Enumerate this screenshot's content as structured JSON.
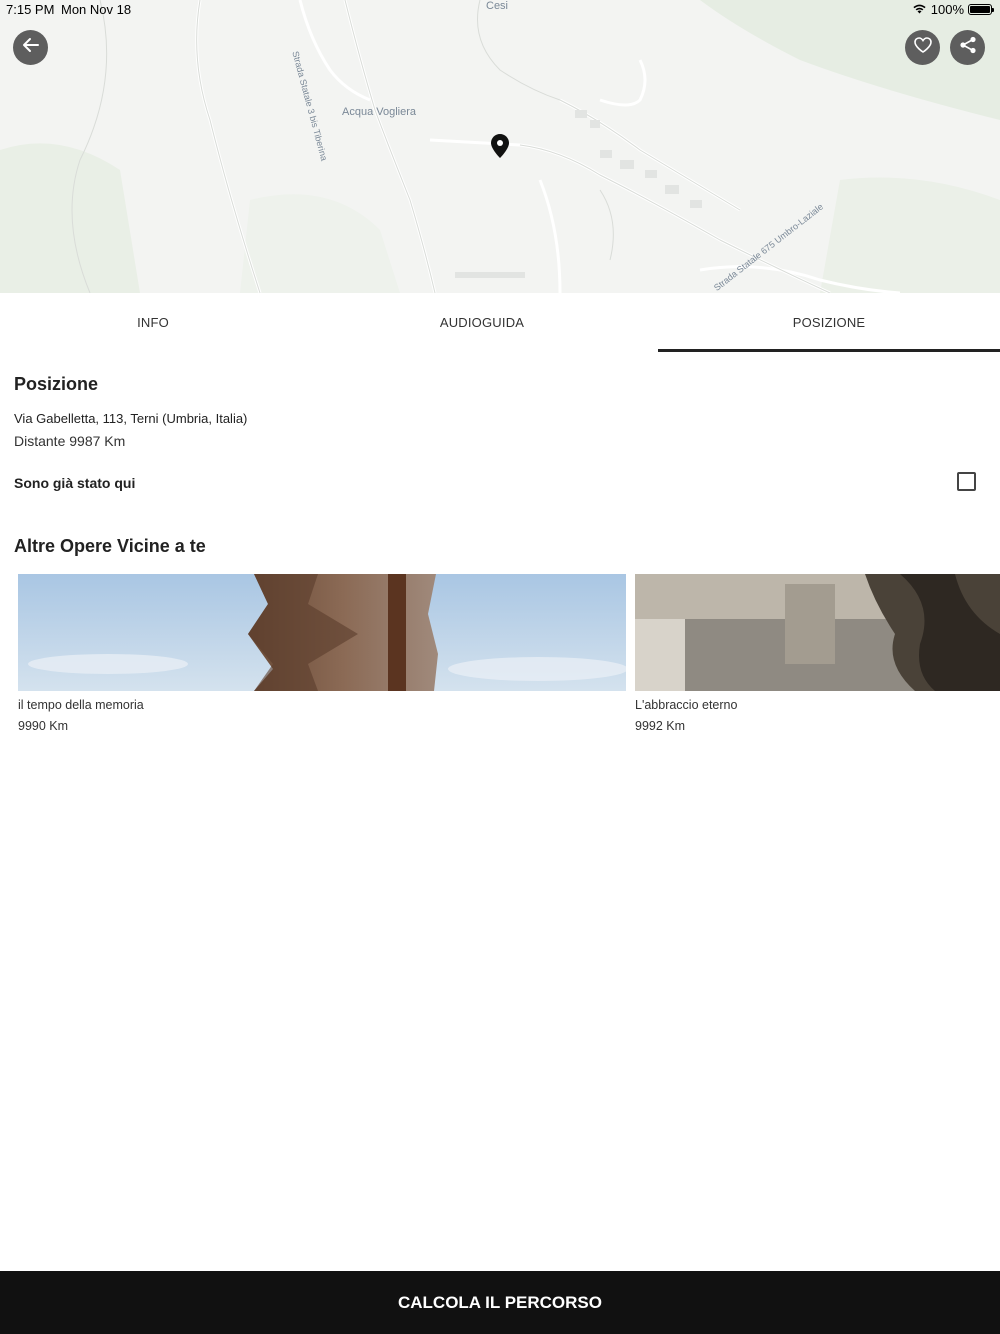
{
  "status_bar": {
    "time": "7:15 PM",
    "date": "Mon Nov 18",
    "battery": "100%"
  },
  "map": {
    "labels": {
      "cesi": "Cesi",
      "acqua_vogliera": "Acqua Vogliera",
      "strada_statale_3bis": "Strada Statale 3 bis Tiberina",
      "strada_statale_675": "Strada Statale 675 Umbro-Laziale"
    },
    "icons": {
      "back": "arrow-left-icon",
      "favorite": "heart-icon",
      "share": "share-icon",
      "pin": "map-pin-icon"
    }
  },
  "tabs": [
    {
      "label": "INFO",
      "active": false
    },
    {
      "label": "AUDIOGUIDA",
      "active": false
    },
    {
      "label": "POSIZIONE",
      "active": true
    }
  ],
  "position": {
    "title": "Posizione",
    "address": "Via Gabelletta, 113, Terni (Umbria, Italia)",
    "distance": "Distante 9987 Km",
    "been_here_label": "Sono già stato qui",
    "been_here_checked": false
  },
  "nearby": {
    "title": "Altre Opere Vicine a te",
    "items": [
      {
        "name": "il tempo della memoria",
        "distance": "9990 Km"
      },
      {
        "name": "L'abbraccio eterno",
        "distance": "9992 Km"
      }
    ]
  },
  "cta_label": "CALCOLA IL PERCORSO",
  "colors": {
    "button_bg": "#5e5e5e",
    "cta_bg": "#111111",
    "tab_indicator": "#222222"
  }
}
